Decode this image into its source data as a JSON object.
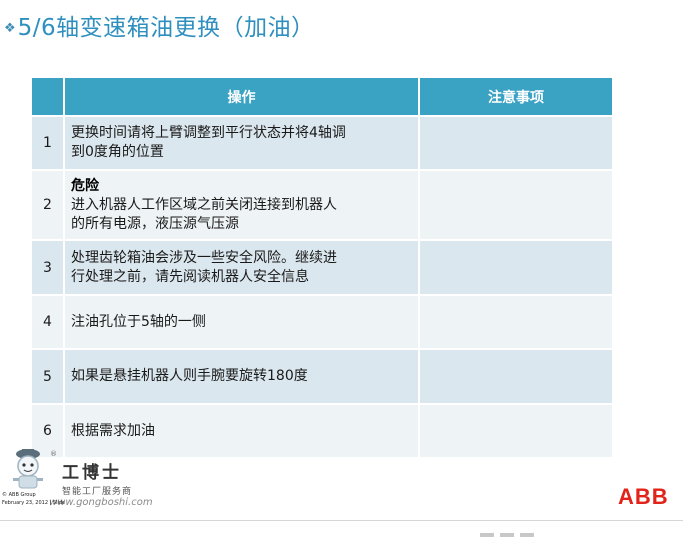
{
  "slide": {
    "title": "5/6轴变速箱油更换（加油）",
    "bullet_icon": "diamond-bullet-icon"
  },
  "table": {
    "headers": {
      "num": "",
      "operation": "操作",
      "notes": "注意事项"
    },
    "rows": [
      {
        "num": "1",
        "lines": [
          "更换时间请将上臂调整到平行状态并将4轴调",
          "到0度角的位置"
        ],
        "note": ""
      },
      {
        "num": "2",
        "heading": "危险",
        "lines": [
          "进入机器人工作区域之前关闭连接到机器人",
          "的所有电源，液压源气压源"
        ],
        "note": ""
      },
      {
        "num": "3",
        "lines": [
          "处理齿轮箱油会涉及一些安全风险。继续进",
          "行处理之前，请先阅读机器人安全信息"
        ],
        "note": ""
      },
      {
        "num": "4",
        "lines": [
          "注油孔位于5轴的一侧"
        ],
        "note": ""
      },
      {
        "num": "5",
        "lines": [
          "如果是悬挂机器人则手腕要旋转180度"
        ],
        "note": ""
      },
      {
        "num": "6",
        "lines": [
          "根据需求加油"
        ],
        "note": ""
      }
    ]
  },
  "watermark": {
    "reg": "®",
    "brand": "工博士",
    "subtitle": "智能工厂服务商",
    "url": "www.gongboshi.com"
  },
  "footer": {
    "copyright": "© ABB Group",
    "date": "February 23, 2012 | Slide"
  },
  "abb_logo_text": "ABB",
  "colors": {
    "title": "#2f8fbf",
    "header_bg": "#3aa3c4",
    "row_bg": "#dbe7ee",
    "row_alt_bg": "#eef3f6",
    "abb_red": "#e2231a"
  }
}
